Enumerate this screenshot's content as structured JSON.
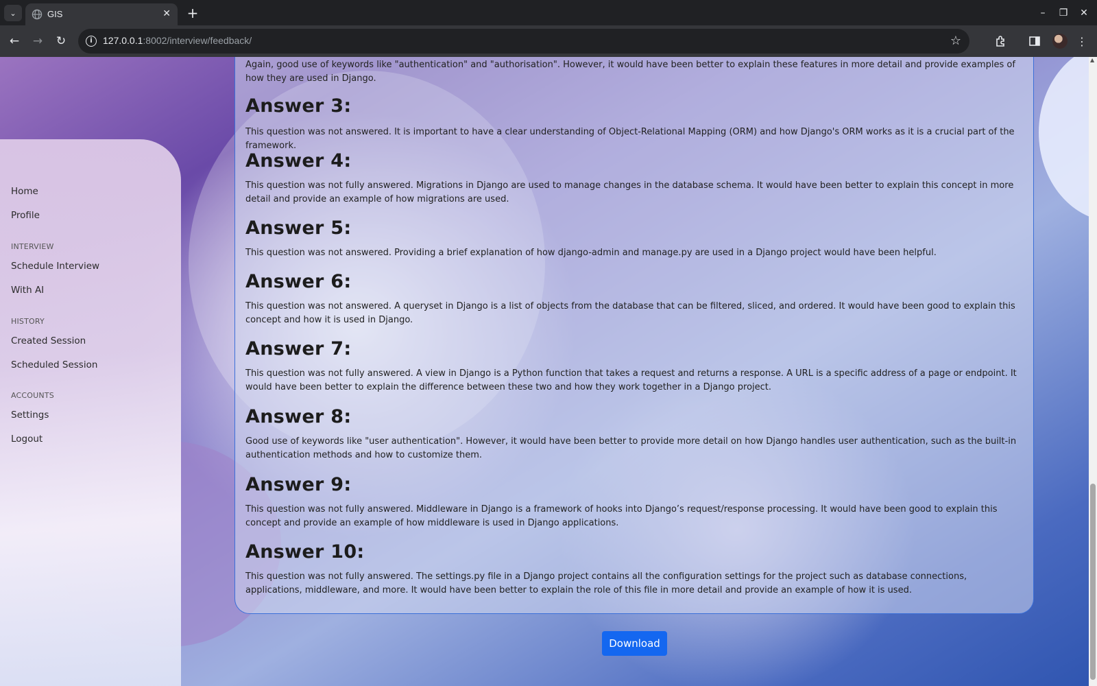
{
  "browser": {
    "tab_title": "GIS",
    "url_host": "127.0.0.1",
    "url_path": ":8002/interview/feedback/"
  },
  "sidebar": {
    "items": [
      {
        "label": "Home"
      },
      {
        "label": "Profile"
      }
    ],
    "sections": [
      {
        "heading": "INTERVIEW",
        "items": [
          {
            "label": "Schedule Interview"
          },
          {
            "label": "With AI"
          }
        ]
      },
      {
        "heading": "HISTORY",
        "items": [
          {
            "label": "Created Session"
          },
          {
            "label": "Scheduled Session"
          }
        ]
      },
      {
        "heading": "ACCOUNTS",
        "items": [
          {
            "label": "Settings"
          },
          {
            "label": "Logout"
          }
        ]
      }
    ]
  },
  "feedback": {
    "intro_text": "Again, good use of keywords like \"authentication\" and \"authorisation\". However, it would have been better to explain these features in more detail and provide examples of how they are used in Django.",
    "answers": [
      {
        "heading": "Answer 3:",
        "text": "This question was not answered. It is important to have a clear understanding of Object-Relational Mapping (ORM) and how Django's ORM works as it is a crucial part of the framework."
      },
      {
        "heading": "Answer 4:",
        "text": "This question was not fully answered. Migrations in Django are used to manage changes in the database schema. It would have been better to explain this concept in more detail and provide an example of how migrations are used."
      },
      {
        "heading": "Answer 5:",
        "text": "This question was not answered. Providing a brief explanation of how django-admin and manage.py are used in a Django project would have been helpful."
      },
      {
        "heading": "Answer 6:",
        "text": "This question was not answered. A queryset in Django is a list of objects from the database that can be filtered, sliced, and ordered. It would have been good to explain this concept and how it is used in Django."
      },
      {
        "heading": "Answer 7:",
        "text": "This question was not fully answered. A view in Django is a Python function that takes a request and returns a response. A URL is a specific address of a page or endpoint. It would have been better to explain the difference between these two and how they work together in a Django project."
      },
      {
        "heading": "Answer 8:",
        "text": "Good use of keywords like \"user authentication\". However, it would have been better to provide more detail on how Django handles user authentication, such as the built-in authentication methods and how to customize them."
      },
      {
        "heading": "Answer 9:",
        "text": "This question was not fully answered. Middleware in Django is a framework of hooks into Django’s request/response processing. It would have been good to explain this concept and provide an example of how middleware is used in Django applications."
      },
      {
        "heading": "Answer 10:",
        "text": "This question was not fully answered. The settings.py file in a Django project contains all the configuration settings for the project such as database connections, applications, middleware, and more. It would have been better to explain the role of this file in more detail and provide an example of how it is used."
      }
    ],
    "download_label": "Download"
  }
}
